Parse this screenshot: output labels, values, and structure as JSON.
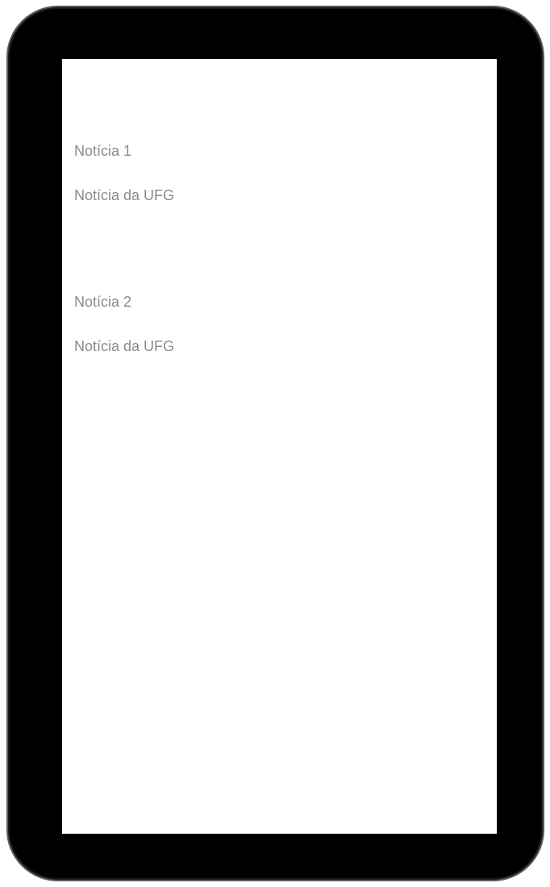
{
  "news": {
    "items": [
      {
        "title": "Notícia 1",
        "subtitle": "Notícia da UFG"
      },
      {
        "title": "Notícia 2",
        "subtitle": "Notícia da UFG"
      }
    ]
  },
  "colors": {
    "device_frame": "#000000",
    "frame_border": "#5a5a5a",
    "screen_background": "#ffffff",
    "text": "#8a8a8a"
  }
}
